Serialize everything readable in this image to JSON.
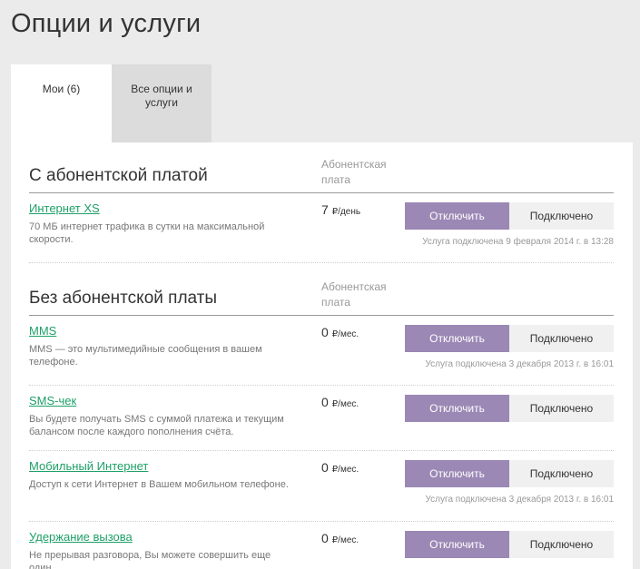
{
  "page": {
    "title": "Опции и услуги"
  },
  "tabs": [
    {
      "label": "Мои (6)"
    },
    {
      "label": "Все опции и услуги"
    }
  ],
  "colors": {
    "accent": "#9b88b5",
    "link": "#1ea067"
  },
  "sections": [
    {
      "title": "С абонентской платой",
      "fee_header": "Абонентская плата",
      "services": [
        {
          "name": "Интернет XS",
          "description": "70 МБ интернет трафика в сутки на максимальной скорости.",
          "price": "7",
          "unit": "₽/день",
          "disable_label": "Отключить",
          "status_label": "Подключено",
          "since": "Услуга подключена 9 февраля 2014 г. в 13:28"
        }
      ]
    },
    {
      "title": "Без абонентской платы",
      "fee_header": "Абонентская плата",
      "services": [
        {
          "name": "MMS",
          "description": "MMS — это мультимедийные сообщения в вашем телефоне.",
          "price": "0",
          "unit": "₽/мес.",
          "disable_label": "Отключить",
          "status_label": "Подключено",
          "since": "Услуга подключена 3 декабря 2013 г. в 16:01"
        },
        {
          "name": "SMS-чек",
          "description": "Вы будете получать SMS с суммой платежа и текущим балансом после каждого пополнения счёта.",
          "price": "0",
          "unit": "₽/мес.",
          "disable_label": "Отключить",
          "status_label": "Подключено",
          "since": ""
        },
        {
          "name": "Мобильный Интернет",
          "description": "Доступ к сети Интернет в Вашем мобильном телефоне.",
          "price": "0",
          "unit": "₽/мес.",
          "disable_label": "Отключить",
          "status_label": "Подключено",
          "since": "Услуга подключена 3 декабря 2013 г. в 16:01"
        },
        {
          "name": "Удержание вызова",
          "description": "Не прерывая разговора, Вы можете совершить еще один",
          "price": "0",
          "unit": "₽/мес.",
          "disable_label": "Отключить",
          "status_label": "Подключено",
          "since": ""
        }
      ]
    }
  ]
}
